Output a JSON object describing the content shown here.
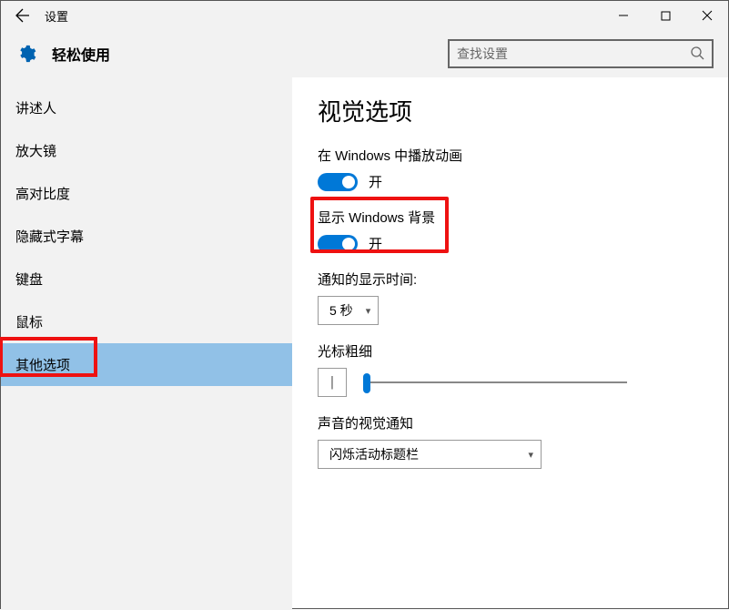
{
  "window": {
    "title": "设置"
  },
  "header": {
    "subtitle": "轻松使用"
  },
  "search": {
    "placeholder": "查找设置"
  },
  "sidebar": {
    "items": [
      {
        "label": "讲述人"
      },
      {
        "label": "放大镜"
      },
      {
        "label": "高对比度"
      },
      {
        "label": "隐藏式字幕"
      },
      {
        "label": "键盘"
      },
      {
        "label": "鼠标"
      },
      {
        "label": "其他选项"
      }
    ],
    "selected_index": 6
  },
  "page": {
    "title": "视觉选项",
    "animations": {
      "label": "在 Windows 中播放动画",
      "state": "开",
      "on": true
    },
    "background": {
      "label": "显示 Windows 背景",
      "state": "开",
      "on": true
    },
    "notification_duration": {
      "label": "通知的显示时间:",
      "value": "5 秒"
    },
    "cursor_thickness": {
      "label": "光标粗细",
      "preview": "|",
      "value": 1,
      "min": 1,
      "max": 20
    },
    "sound_visual": {
      "label": "声音的视觉通知",
      "value": "闪烁活动标题栏"
    }
  }
}
